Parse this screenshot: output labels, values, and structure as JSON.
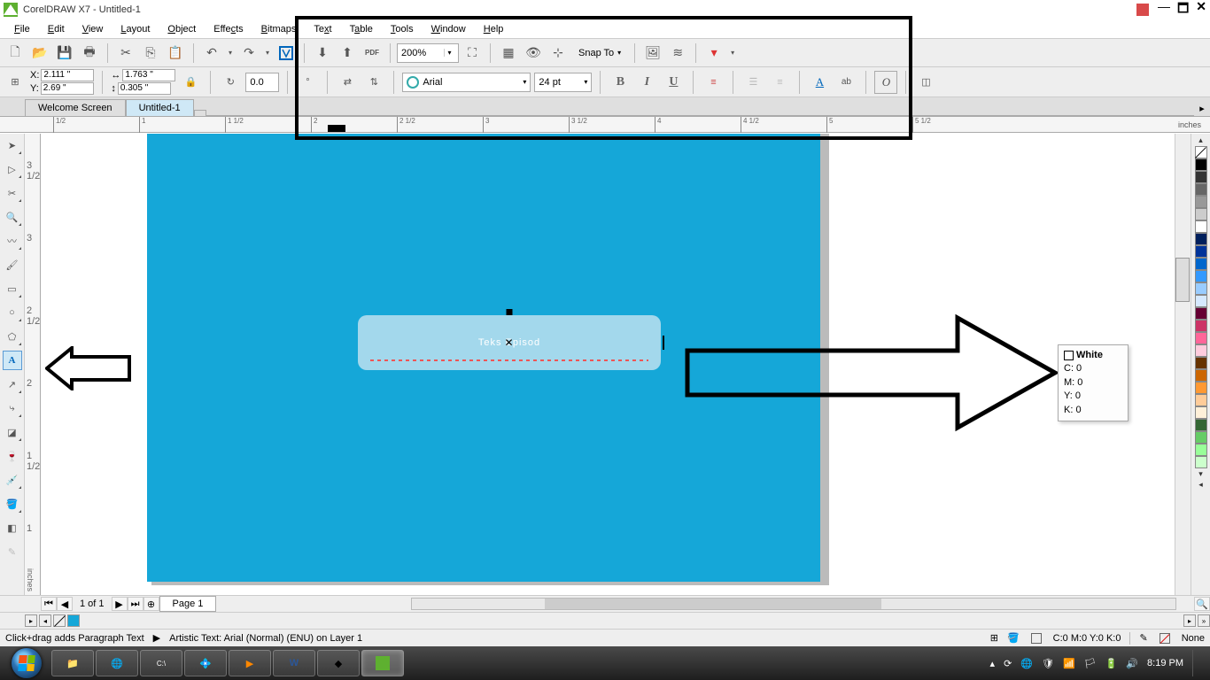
{
  "titlebar": {
    "app_title": "CorelDRAW X7 - Untitled-1"
  },
  "menubar": {
    "items": [
      "File",
      "Edit",
      "View",
      "Layout",
      "Object",
      "Effects",
      "Bitmaps",
      "Text",
      "Table",
      "Tools",
      "Window",
      "Help"
    ]
  },
  "toolbar": {
    "zoom": "200%",
    "snap_label": "Snap To"
  },
  "propsbar": {
    "x_label": "X:",
    "x_val": "2.111 \"",
    "y_label": "Y:",
    "y_val": "2.69 \"",
    "w_val": "1.763 \"",
    "h_val": "0.305 \"",
    "rotation": "0.0",
    "deg_sym": "°",
    "font_name": "Arial",
    "font_size": "24 pt",
    "bold": "B",
    "italic": "I",
    "underline": "U",
    "text_A": "A",
    "text_ab": "ab",
    "text_O": "O"
  },
  "tabs": {
    "welcome": "Welcome Screen",
    "doc": "Untitled-1"
  },
  "ruler": {
    "unit_h": "inches",
    "unit_v": "inches",
    "h_ticks": [
      "1/2",
      "1",
      "1 1/2",
      "2",
      "2 1/2",
      "3",
      "3 1/2",
      "4",
      "4 1/2",
      "5",
      "5 1/2"
    ],
    "v_ticks": [
      "1",
      "1 1/2",
      "2",
      "2 1/2",
      "3",
      "3 1/2"
    ]
  },
  "canvas": {
    "text_content": "Teks Episod"
  },
  "color_tooltip": {
    "name": "White",
    "c": "C: 0",
    "m": "M: 0",
    "y": "Y: 0",
    "k": "K: 0"
  },
  "palette_colors": [
    "none",
    "#000",
    "#333",
    "#666",
    "#999",
    "#ccc",
    "#fff",
    "#001f5c",
    "#003399",
    "#0066cc",
    "#3399ff",
    "#99ccff",
    "#d6e9ff",
    "#660033",
    "#cc3366",
    "#ff6699",
    "#ffccdd",
    "#663300",
    "#cc6600",
    "#ff9933",
    "#ffcc99",
    "#fff0d9",
    "#336633",
    "#66cc66",
    "#99ff99",
    "#ccffcc"
  ],
  "page_nav": {
    "count": "1 of 1",
    "page_label": "Page 1"
  },
  "statusbar": {
    "hint": "Click+drag adds Paragraph Text",
    "obj_info": "Artistic Text: Arial (Normal) (ENU) on Layer 1",
    "fill_label": "C:0 M:0 Y:0 K:0",
    "outline_label": "None"
  },
  "taskbar": {
    "clock": "8:19 PM"
  }
}
